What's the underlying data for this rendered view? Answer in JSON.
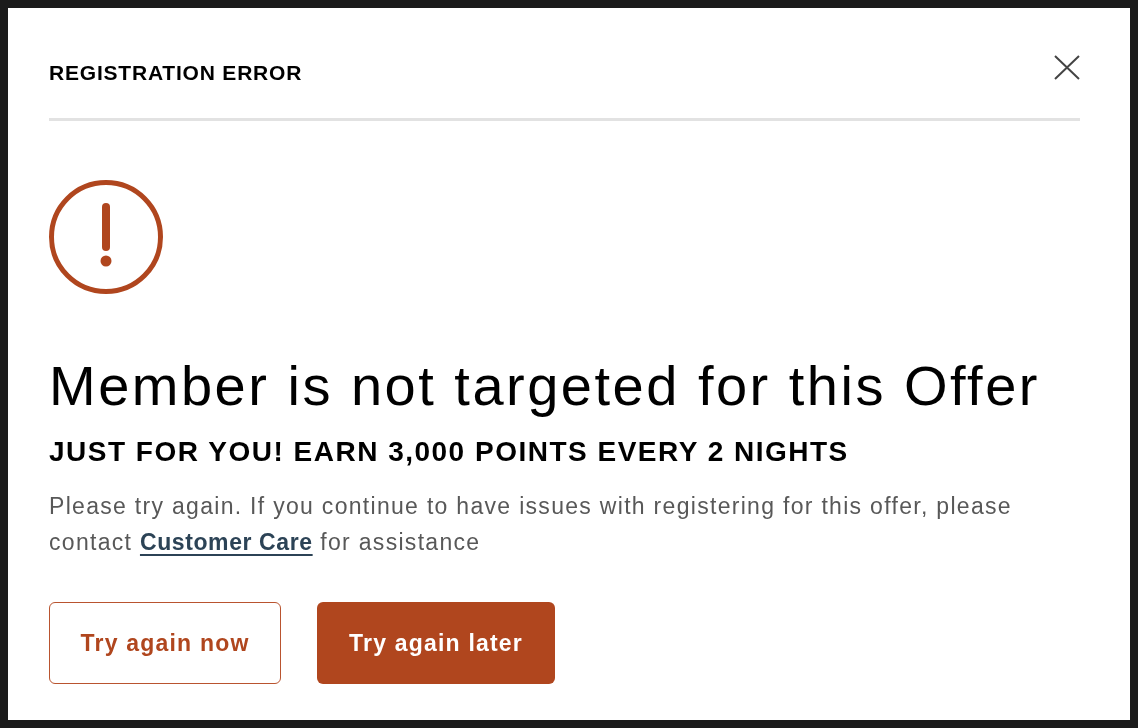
{
  "dialog": {
    "title": "REGISTRATION ERROR"
  },
  "error": {
    "heading": "Member is not targeted for this Offer",
    "subtitle": "JUST FOR YOU! EARN 3,000 POINTS EVERY 2 NIGHTS",
    "message": {
      "text_before": "Please try again. If you continue to have issues with registering for this offer, please contact",
      "link": "Customer Care",
      "text_after": "for assistance"
    }
  },
  "buttons": [
    {
      "label": "Try again now",
      "kind": "secondary"
    },
    {
      "label": "Try again later",
      "kind": "primary"
    }
  ]
}
